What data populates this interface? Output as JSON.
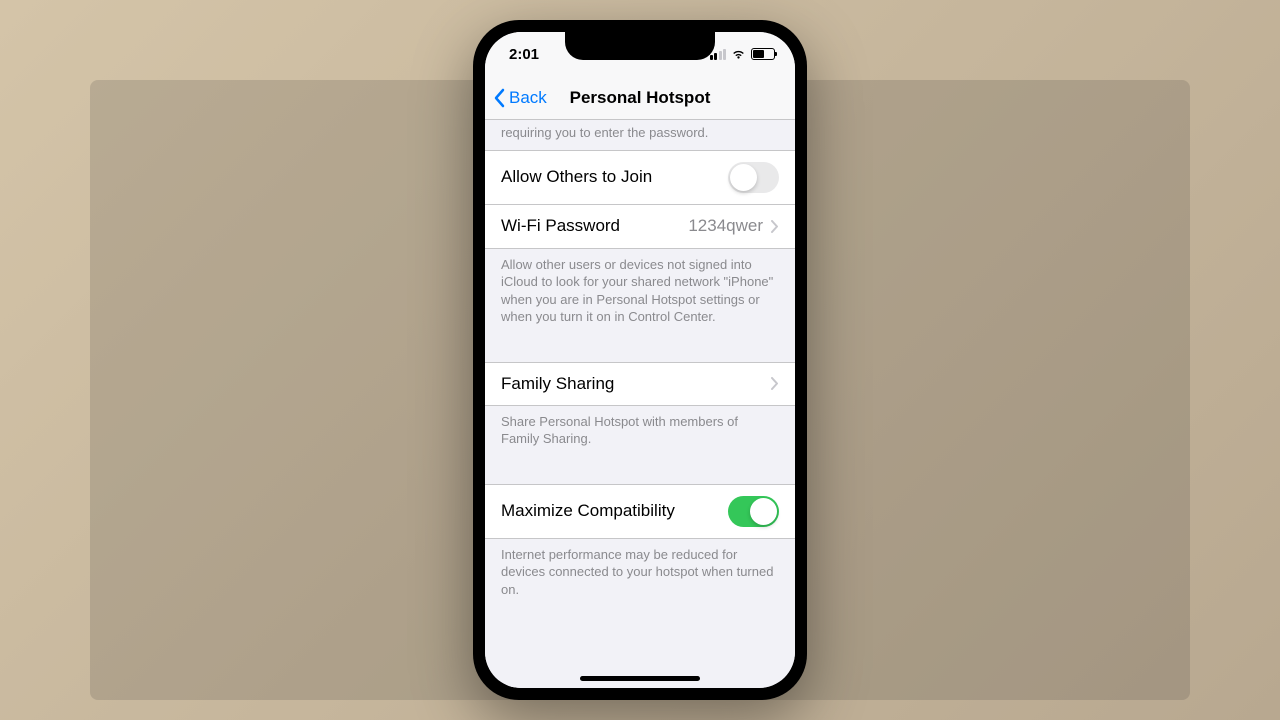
{
  "status": {
    "time": "2:01"
  },
  "nav": {
    "back_label": "Back",
    "title": "Personal Hotspot"
  },
  "header_desc": "requiring you to enter the password.",
  "rows": {
    "allow_label": "Allow Others to Join",
    "wifi_label": "Wi-Fi Password",
    "wifi_value": "1234qwer",
    "family_label": "Family Sharing",
    "maxcompat_label": "Maximize Compatibility"
  },
  "footers": {
    "allow": "Allow other users or devices not signed into iCloud to look for your shared network \"iPhone\" when you are in Personal Hotspot settings or when you turn it on in Control Center.",
    "family": "Share Personal Hotspot with members of Family Sharing.",
    "maxcompat": "Internet performance may be reduced for devices connected to your hotspot when turned on."
  },
  "toggles": {
    "allow_others": false,
    "max_compat": true
  }
}
